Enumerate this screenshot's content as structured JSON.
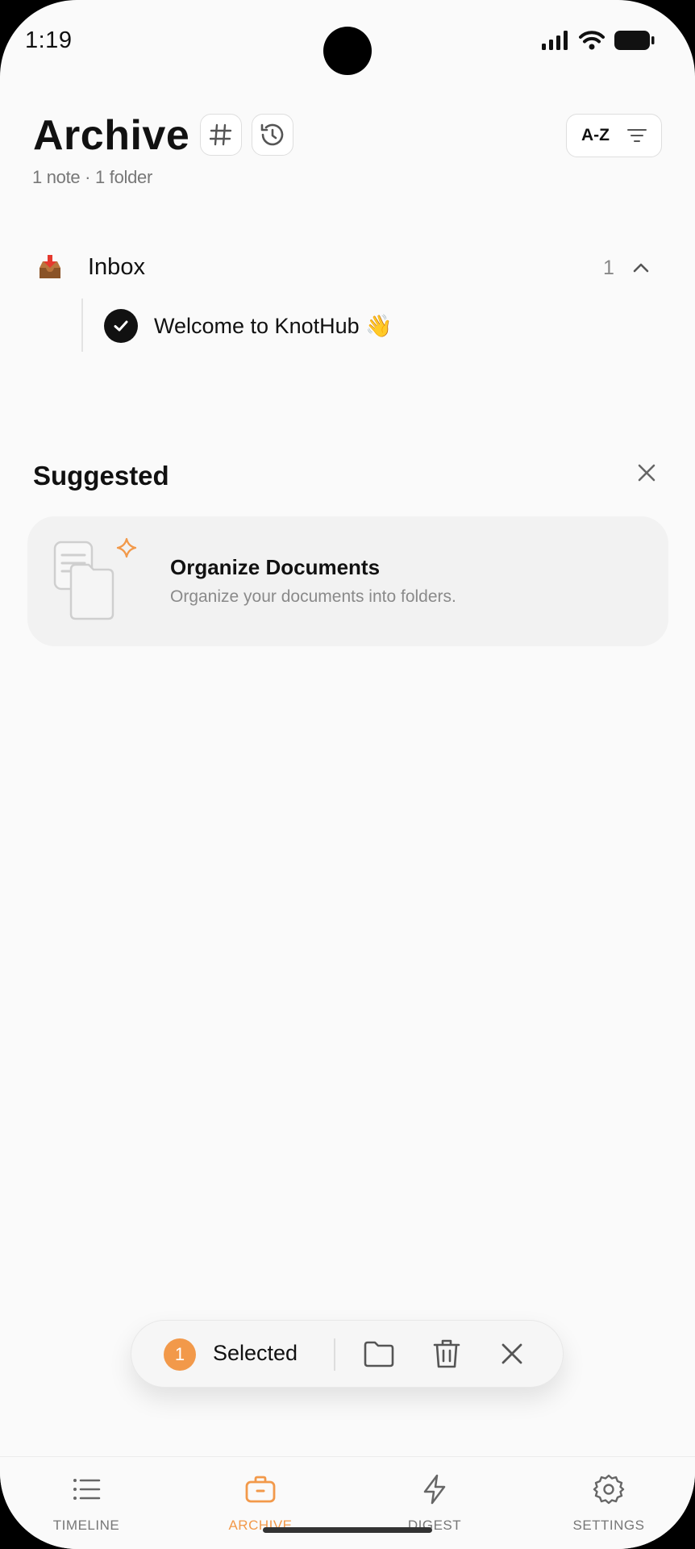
{
  "status": {
    "time": "1:19"
  },
  "header": {
    "title": "Archive",
    "subtitle": "1 note · 1 folder",
    "sort_label": "A-Z"
  },
  "folders": [
    {
      "name": "Inbox",
      "count": "1",
      "icon": "inbox-tray-icon",
      "expanded": true,
      "notes": [
        {
          "title": "Welcome to KnotHub 👋",
          "selected": true
        }
      ]
    }
  ],
  "suggested": {
    "title": "Suggested",
    "card": {
      "title": "Organize Documents",
      "description": "Organize your documents into folders."
    }
  },
  "selection": {
    "count": "1",
    "label": "Selected"
  },
  "tabs": [
    {
      "label": "TIMELINE",
      "icon": "list-icon",
      "active": false
    },
    {
      "label": "ARCHIVE",
      "icon": "briefcase-icon",
      "active": true
    },
    {
      "label": "DIGEST",
      "icon": "lightning-icon",
      "active": false
    },
    {
      "label": "SETTINGS",
      "icon": "gear-icon",
      "active": false
    }
  ],
  "colors": {
    "accent": "#F2994A",
    "text": "#111111",
    "muted": "#777777",
    "background": "#FAFAFA"
  }
}
